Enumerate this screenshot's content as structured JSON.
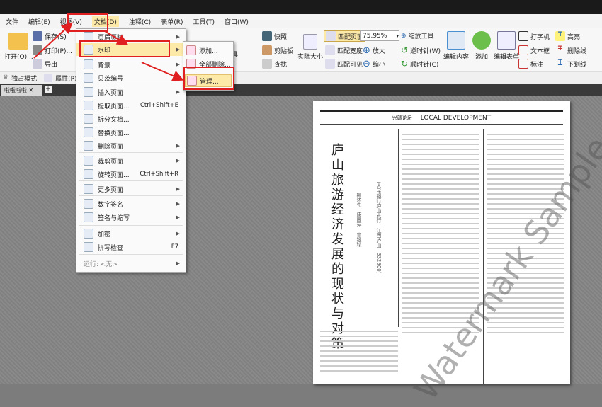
{
  "menubar": [
    "文件",
    "编辑(E)",
    "视图(V)",
    "文档(D)",
    "注释(C)",
    "表单(R)",
    "工具(T)",
    "窗口(W)"
  ],
  "toolbar": {
    "open": "打开(O)...",
    "save": "保存(S)",
    "print": "打印(P)...",
    "export": "导出",
    "snapshot": "快照",
    "clipboard": "剪贴板",
    "find": "查找",
    "annot_tool": "注释工具",
    "actual_size": "实际大小",
    "fit_page": "匹配页面",
    "fit_width": "匹配宽度",
    "fit_visible": "匹配可见",
    "zoom": "75.95%",
    "zoom_tool": "缩放工具",
    "zoom_in": "放大",
    "zoom_out": "缩小",
    "ccw": "逆时针(W)",
    "cw": "顺时针(C)",
    "edit_content": "编辑内容",
    "add": "添加",
    "edit_form": "编辑表单",
    "typewriter": "打字机",
    "textbox": "文本框",
    "callout": "标注",
    "highlight": "高亮",
    "strikeout": "删除线",
    "underline": "下划线"
  },
  "toolbar2": {
    "exclusive": "独占模式",
    "properties": "属性(P)..."
  },
  "tab": {
    "label": "啦啦啦啦"
  },
  "menu": {
    "items": [
      {
        "label": "页眉页脚",
        "arrow": true
      },
      {
        "label": "水印",
        "arrow": true
      },
      {
        "label": "背景",
        "arrow": true
      },
      {
        "label": "贝茨编号"
      },
      {
        "label": "插入页面",
        "arrow": true
      },
      {
        "label": "提取页面...",
        "shortcut": "Ctrl+Shift+E"
      },
      {
        "label": "拆分文档..."
      },
      {
        "label": "替换页面..."
      },
      {
        "label": "删除页面",
        "arrow": true
      },
      {
        "label": "裁剪页面",
        "arrow": true
      },
      {
        "label": "旋转页面...",
        "shortcut": "Ctrl+Shift+R"
      },
      {
        "label": "更多页面",
        "arrow": true
      },
      {
        "label": "数字签名",
        "arrow": true
      },
      {
        "label": "签名与缩写",
        "arrow": true
      },
      {
        "label": "加密",
        "arrow": true
      },
      {
        "label": "拼写检查",
        "shortcut": "F7"
      },
      {
        "label": "运行: <无>",
        "arrow": true
      }
    ]
  },
  "submenu": [
    "添加...",
    "全部删除...",
    "管理..."
  ],
  "page": {
    "header_left": "兴赣论坛",
    "header_right": "LOCAL DEVELOPMENT",
    "title": "庐山旅游经济发展的现状与对策",
    "authors": "柳述先　唐国萍　曾银球",
    "affiliation": "（人民银行庐山支行　江西庐山　332900）",
    "watermark": "Watermark Sample"
  }
}
